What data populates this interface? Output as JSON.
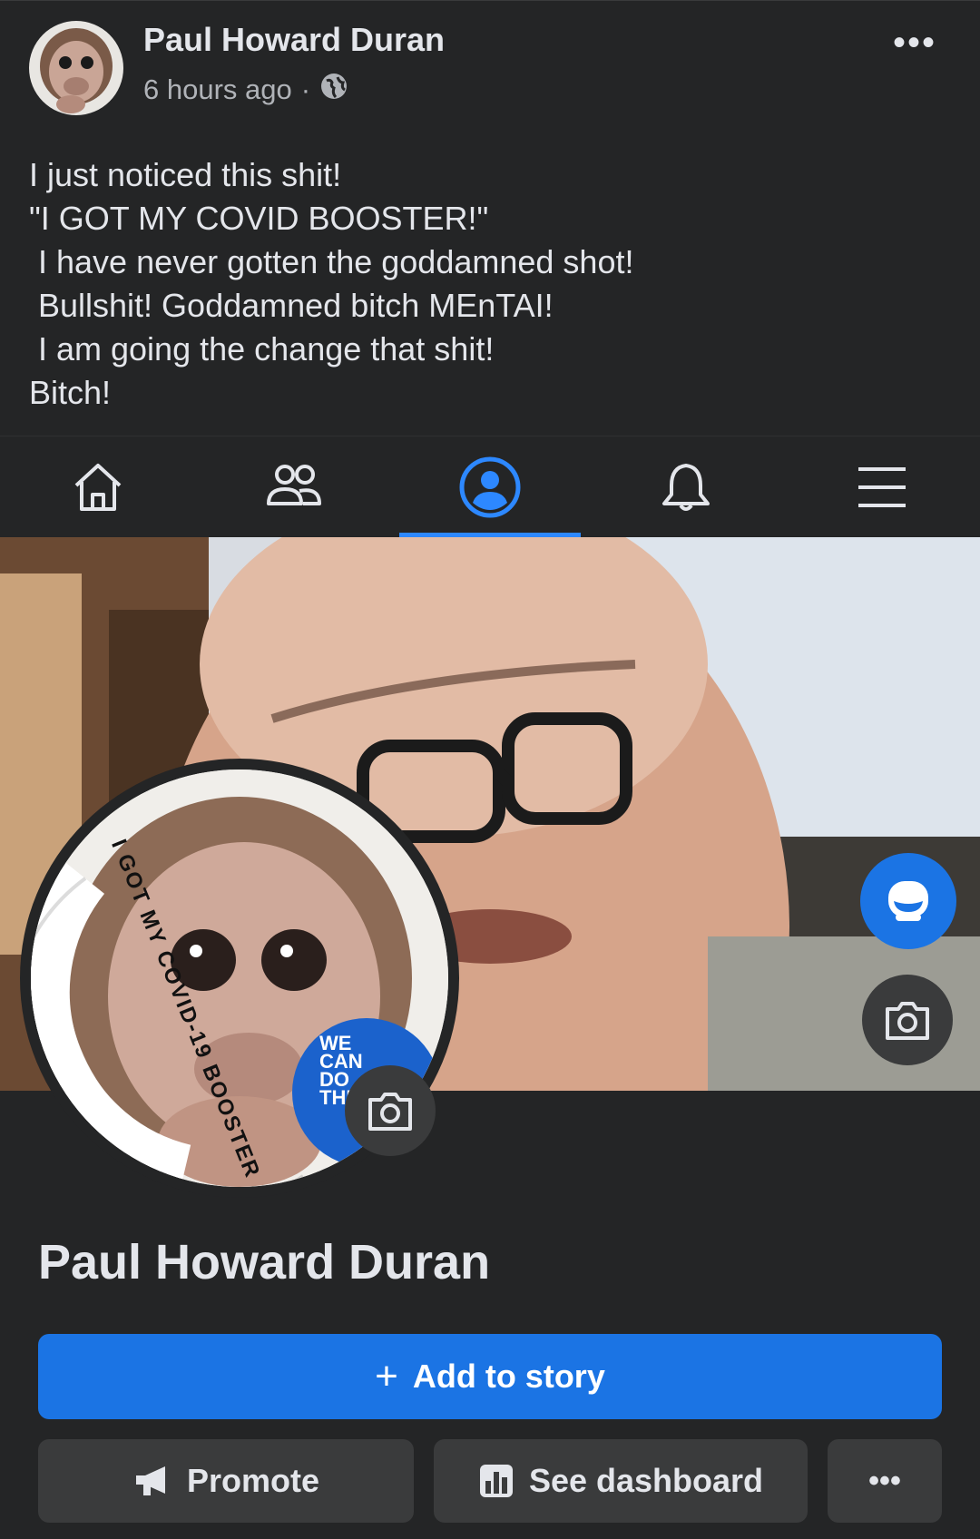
{
  "post": {
    "author": "Paul Howard Duran",
    "time": "6 hours ago",
    "separator": "·",
    "more": "•••",
    "lines": [
      "I just noticed this shit!",
      "\"I GOT MY COVID BOOSTER!\"",
      " I have never gotten the goddamned shot!",
      " Bullshit! Goddamned bitch MEnTAI!",
      " I am going the change that shit!",
      "Bitch!"
    ]
  },
  "nav": {
    "items": [
      "home-icon",
      "friends-icon",
      "profile-icon",
      "notifications-icon",
      "menu-icon"
    ],
    "active": "profile-icon",
    "accent": "#2d88ff"
  },
  "profile": {
    "frame_text": "I GOT MY COVID-19 BOOSTER",
    "badge_text": [
      "WE",
      "CAN",
      "DO",
      "THI"
    ],
    "name": "Paul Howard Duran",
    "add_story": "Add to story",
    "add_story_icon": "+",
    "promote": "Promote",
    "dashboard": "See dashboard",
    "more": "•••"
  }
}
